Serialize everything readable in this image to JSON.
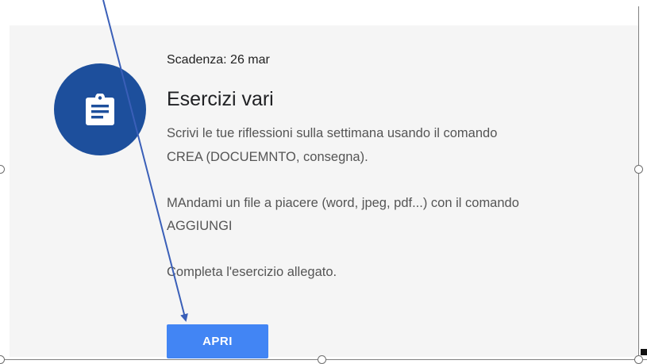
{
  "assignment": {
    "icon": "assignment-clipboard-icon",
    "due_date": "Scadenza: 26 mar",
    "title": "Esercizi vari",
    "description_lines": [
      "Scrivi le tue riflessioni sulla settimana usando il comando",
      "CREA (DOCUEMNTO, consegna).",
      "MAndami un file a piacere (word, jpeg, pdf...) con il comando",
      "AGGIUNGI",
      "Completa l'esercizio allegato."
    ],
    "open_label": "APRI"
  },
  "annotation": {
    "arrow": "pointer-arrow",
    "arrow_color": "#3a5fb8"
  },
  "colors": {
    "card_background": "#f5f5f5",
    "icon_circle": "#1d4f9c",
    "button": "#4285f4",
    "description_text": "#555555"
  }
}
